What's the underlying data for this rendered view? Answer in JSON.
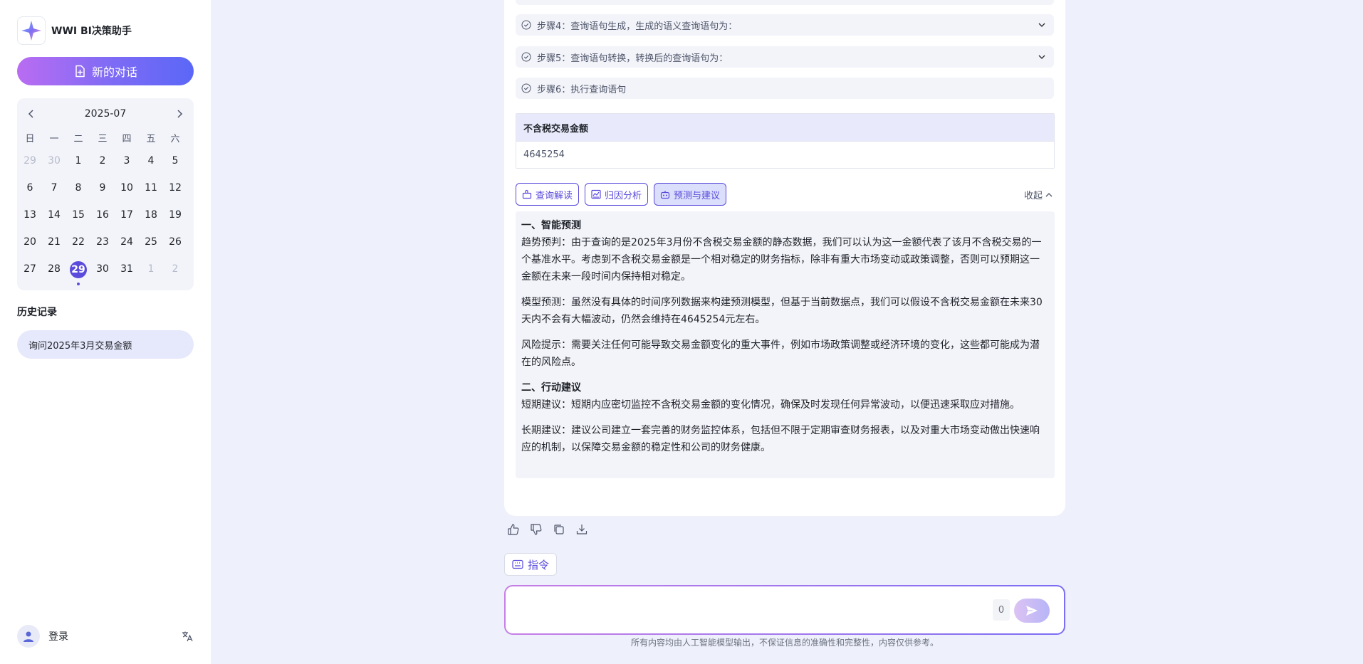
{
  "app": {
    "title": "WWI BI决策助手",
    "accent": "#5a4bdc"
  },
  "sidebar": {
    "new_chat_label": "新的对话",
    "calendar": {
      "title": "2025-07",
      "weekdays": [
        "日",
        "一",
        "二",
        "三",
        "四",
        "五",
        "六"
      ],
      "weeks": [
        [
          "29",
          "30",
          "1",
          "2",
          "3",
          "4",
          "5"
        ],
        [
          "6",
          "7",
          "8",
          "9",
          "10",
          "11",
          "12"
        ],
        [
          "13",
          "14",
          "15",
          "16",
          "17",
          "18",
          "19"
        ],
        [
          "20",
          "21",
          "22",
          "23",
          "24",
          "25",
          "26"
        ],
        [
          "27",
          "28",
          "29",
          "30",
          "31",
          "1",
          "2"
        ]
      ],
      "selected": "29"
    },
    "history_title": "历史记录",
    "history_items": [
      "询问2025年3月交易金额"
    ],
    "user_label": "登录"
  },
  "main": {
    "steps": [
      "步骤4：查询语句生成，生成的语义查询语句为：",
      "步骤5：查询语句转换，转换后的查询语句为：",
      "步骤6：执行查询语句"
    ],
    "table": {
      "header": "不含税交易金额",
      "value": "4645254"
    },
    "tabs": [
      "查询解读",
      "归因分析",
      "预测与建议"
    ],
    "collapse_label": "收起",
    "analysis": {
      "section1_title": "一、智能预测",
      "p1": "趋势预判：由于查询的是2025年3月份不含税交易金额的静态数据，我们可以认为这一金额代表了该月不含税交易的一个基准水平。考虑到不含税交易金额是一个相对稳定的财务指标，除非有重大市场变动或政策调整，否则可以预期这一金额在未来一段时间内保持相对稳定。",
      "p2": "模型预测：虽然没有具体的时间序列数据来构建预测模型，但基于当前数据点，我们可以假设不含税交易金额在未来30天内不会有大幅波动，仍然会维持在4645254元左右。",
      "p3": "风险提示：需要关注任何可能导致交易金额变化的重大事件，例如市场政策调整或经济环境的变化，这些都可能成为潜在的风险点。",
      "section2_title": "二、行动建议",
      "p4": "短期建议：短期内应密切监控不含税交易金额的变化情况，确保及时发现任何异常波动，以便迅速采取应对措施。",
      "p5": "长期建议：建议公司建立一套完善的财务监控体系，包括但不限于定期审查财务报表，以及对重大市场变动做出快速响应的机制，以保障交易金额的稳定性和公司的财务健康。"
    },
    "command_label": "指令",
    "input": {
      "value": "",
      "counter": "0"
    },
    "disclaimer": "所有内容均由人工智能模型输出，不保证信息的准确性和完整性，内容仅供参考。"
  }
}
